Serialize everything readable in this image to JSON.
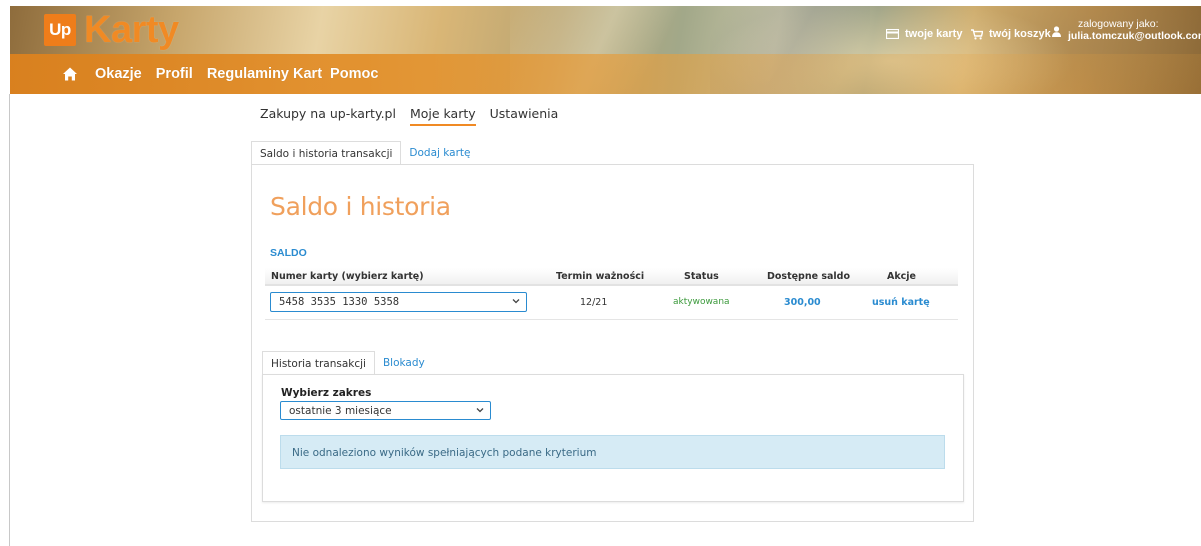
{
  "header": {
    "logo_up": "Up",
    "logo_name": "Karty",
    "nav": [
      "Okazje",
      "Profil",
      "Regulaminy Kart",
      "Pomoc"
    ],
    "links": {
      "my_cards": "twoje karty",
      "cart": "twój koszyk",
      "logged_label": "zalogowany jako:",
      "user_email": "julia.tomczuk@outlook.com"
    }
  },
  "subnav": {
    "items": [
      "Zakupy na up-karty.pl",
      "Moje karty",
      "Ustawienia"
    ],
    "active": "Moje karty"
  },
  "tabs": {
    "items": [
      "Saldo i historia transakcji",
      "Dodaj kartę"
    ],
    "active": "Saldo i historia transakcji"
  },
  "main": {
    "heading": "Saldo i historia",
    "saldo_label": "SALDO",
    "columns": [
      "Numer karty (wybierz kartę)",
      "Termin ważności",
      "Status",
      "Dostępne saldo",
      "Akcje"
    ],
    "row": {
      "card_number": "5458 3535 1330 5358",
      "expiry": "12/21",
      "status": "aktywowana",
      "balance": "300,00",
      "action": "usuń kartę"
    }
  },
  "history": {
    "tabs": [
      "Historia transakcji",
      "Blokady"
    ],
    "active_tab": "Historia transakcji",
    "range_label": "Wybierz zakres",
    "range_value": "ostatnie 3 miesiące",
    "empty_message": "Nie odnaleziono wyników spełniających podane kryterium"
  },
  "colors": {
    "brand_orange": "#f08a24",
    "link_blue": "#2a8bd0",
    "status_green": "#3c9a3c",
    "info_bg": "#d6ebf5"
  }
}
